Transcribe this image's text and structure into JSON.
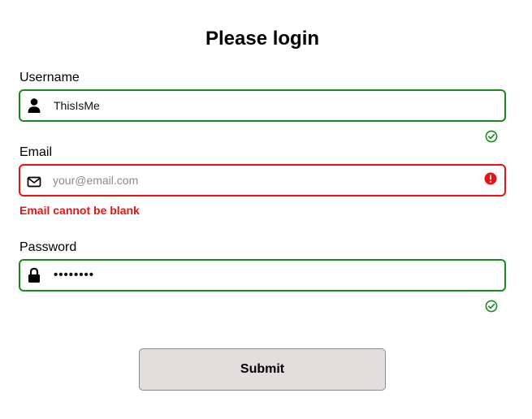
{
  "form": {
    "title": "Please login",
    "username": {
      "label": "Username",
      "value": "ThisIsMe",
      "status": "valid"
    },
    "email": {
      "label": "Email",
      "value": "",
      "placeholder": "your@email.com",
      "status": "error",
      "error_message": "Email cannot be blank"
    },
    "password": {
      "label": "Password",
      "value_masked": "••••••••",
      "status": "valid"
    },
    "submit_label": "Submit"
  },
  "icons": {
    "username": "user-icon",
    "email": "envelope-icon",
    "password": "lock-icon",
    "valid": "check-circle-icon",
    "error": "exclamation-circle-icon"
  },
  "colors": {
    "valid": "#1a8a1a",
    "error": "#ee1111",
    "button_bg": "#e1dedd"
  }
}
